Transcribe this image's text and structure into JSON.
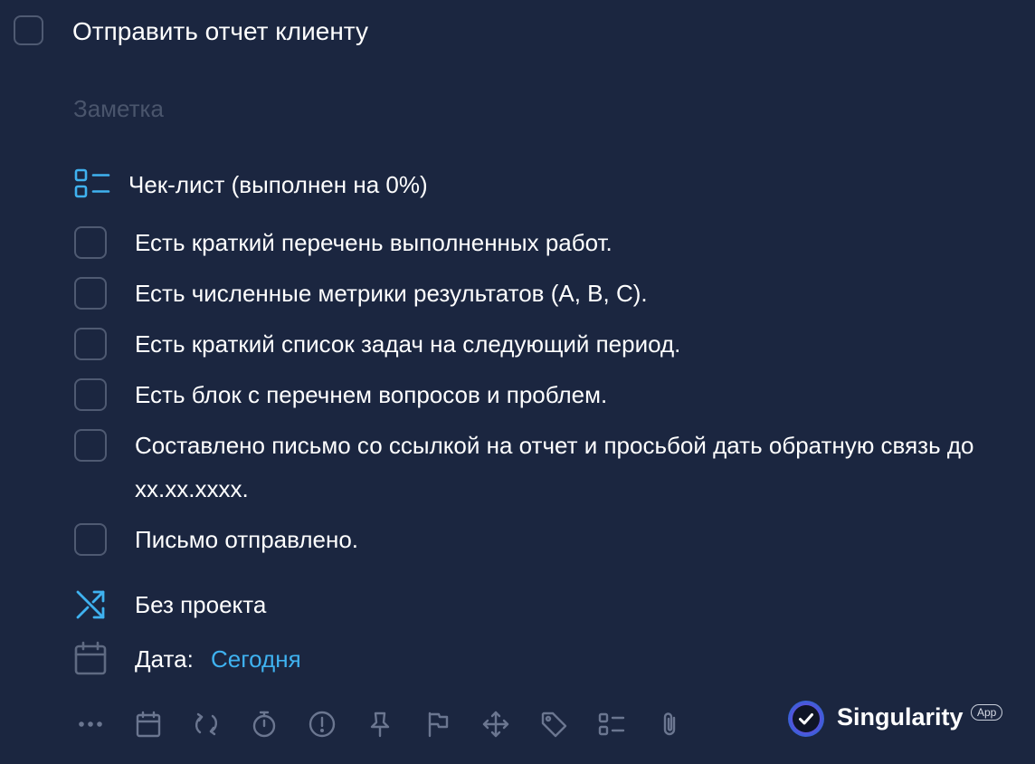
{
  "task": {
    "title": "Отправить отчет клиенту",
    "note_placeholder": "Заметка"
  },
  "checklist": {
    "title": "Чек-лист (выполнен на 0%)",
    "progress_percent": 0,
    "items": [
      {
        "label": "Есть краткий перечень выполненных работ.",
        "checked": false
      },
      {
        "label": "Есть численные метрики результатов (А, В, С).",
        "checked": false
      },
      {
        "label": "Есть краткий список задач на следующий период.",
        "checked": false
      },
      {
        "label": "Есть блок с перечнем вопросов и проблем.",
        "checked": false
      },
      {
        "label": "Составлено письмо со ссылкой на отчет и просьбой дать обратную связь до хх.хх.хххх.",
        "checked": false
      },
      {
        "label": "Письмо отправлено.",
        "checked": false
      }
    ]
  },
  "project": {
    "label": "Без проекта",
    "icon": "shuffle-icon"
  },
  "date": {
    "label": "Дата:",
    "value": "Сегодня",
    "icon": "calendar-icon"
  },
  "toolbar": {
    "icons": [
      "more-icon",
      "calendar-icon",
      "repeat-icon",
      "timer-icon",
      "priority-icon",
      "pin-icon",
      "flag-icon",
      "move-icon",
      "tag-icon",
      "checklist-icon",
      "attachment-icon"
    ]
  },
  "branding": {
    "name": "Singularity",
    "badge": "App"
  },
  "colors": {
    "background": "#1b2640",
    "accent": "#3fb2f0",
    "checkbox_border": "#4f5a72",
    "toolbar_icon": "#6b7690"
  }
}
